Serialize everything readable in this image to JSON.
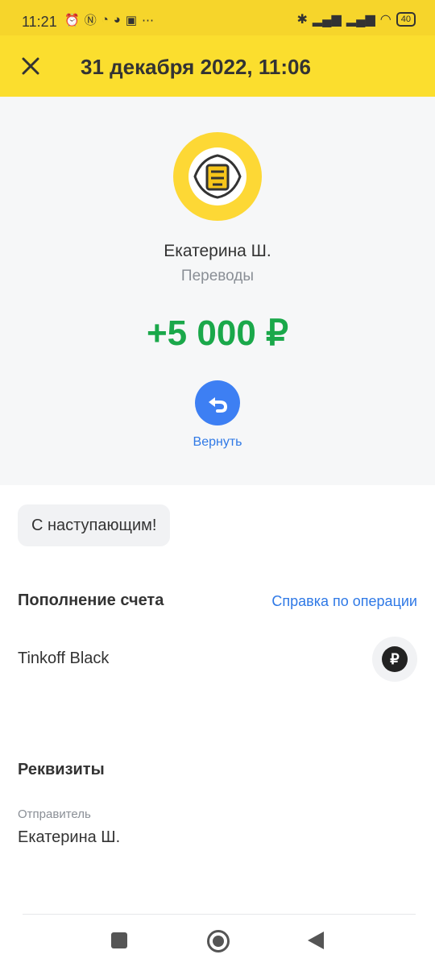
{
  "status_bar": {
    "time": "11:21",
    "battery": "40",
    "left_icons": [
      "alarm-icon",
      "nfc-icon",
      "whatsapp-icon",
      "viber-icon",
      "notification-icon",
      "more-icon"
    ],
    "right_icons": [
      "bluetooth-icon",
      "signal-icon",
      "signal-icon",
      "wifi-icon",
      "battery-icon"
    ]
  },
  "header": {
    "title": "31 декабря 2022, 11:06"
  },
  "transaction": {
    "counterparty": "Екатерина Ш.",
    "category": "Переводы",
    "amount": "+5 000 ₽",
    "amount_color": "#1aa84a",
    "return_label": "Вернуть"
  },
  "message": "С наступающим!",
  "details": {
    "section_title": "Пополнение счета",
    "help_link": "Справка по операции",
    "account_name": "Tinkoff Black",
    "account_currency_symbol": "₽"
  },
  "requisites": {
    "section_title": "Реквизиты",
    "sender_label": "Отправитель",
    "sender_value": "Екатерина Ш."
  },
  "colors": {
    "brand_yellow": "#fbde2e",
    "link_blue": "#2f79e6"
  }
}
